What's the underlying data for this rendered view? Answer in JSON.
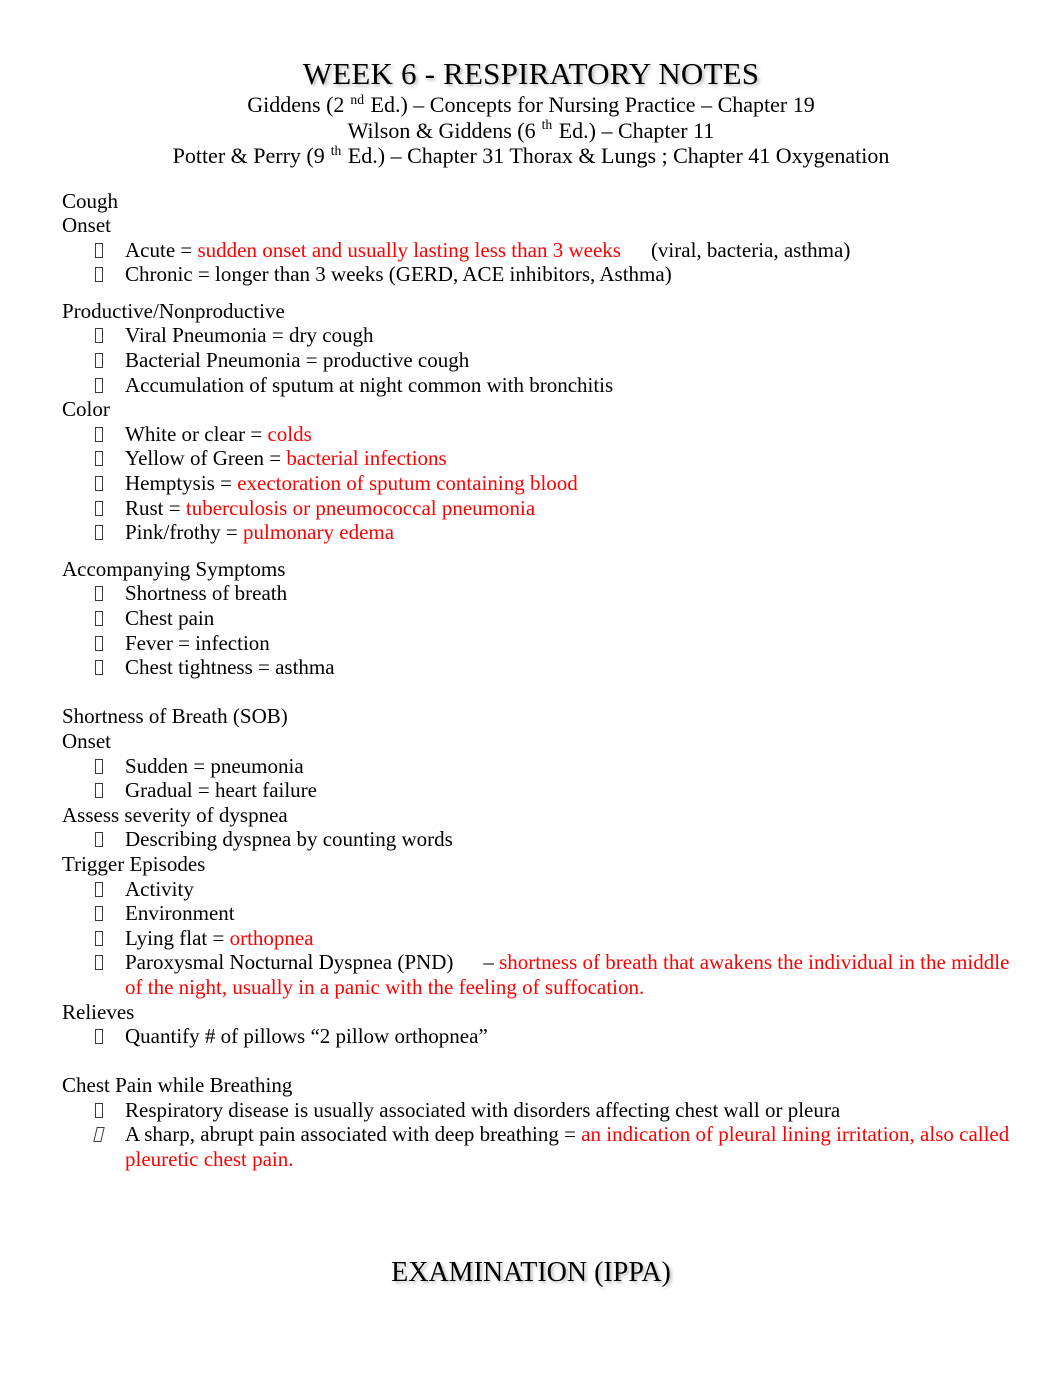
{
  "document": {
    "title": "WEEK 6 - RESPIRATORY NOTES",
    "subtitles": [
      {
        "pre": "Giddens (2",
        "sup": "nd",
        "post": " Ed.) – Concepts for Nursing Practice – Chapter 19"
      },
      {
        "pre": "Wilson & Giddens (6",
        "sup": "th",
        "post": " Ed.) – Chapter 11"
      },
      {
        "pre": "Potter & Perry (9",
        "sup": "th",
        "post": " Ed.) – Chapter 31 Thorax & Lungs ; Chapter 41 Oxygenation"
      }
    ],
    "bottom_heading": "EXAMINATION (IPPA)"
  },
  "colors": {
    "emphasis_red": "#ff0000",
    "body_text": "#000000",
    "bullet_glyph": "#3a3a3a"
  },
  "sections": {
    "cough": {
      "heading": "Cough",
      "onset_heading": "Onset",
      "onset_items": {
        "acute_label": "Acute = ",
        "acute_red": "sudden onset and usually lasting less than 3 weeks",
        "acute_trail": "(viral, bacteria, asthma)",
        "chronic": "Chronic = longer than 3 weeks (GERD, ACE inhibitors, Asthma)"
      },
      "productive_heading": "Productive/Nonproductive",
      "productive_items": {
        "viral": "Viral Pneumonia = dry cough",
        "bacterial": "Bacterial Pneumonia = productive cough",
        "accumulation": "Accumulation of sputum at night common with bronchitis"
      },
      "color_heading": "Color",
      "color_items": {
        "white_label": "White or clear = ",
        "white_red": "colds",
        "yellow_label": "Yellow of Green = ",
        "yellow_red": "bacterial infections",
        "hemoptysis_label": "Hemptysis = ",
        "hemoptysis_red": "exectoration of sputum containing blood",
        "rust_label": "Rust = ",
        "rust_red": "tuberculosis or pneumococcal pneumonia",
        "pink_label": "Pink/frothy = ",
        "pink_red": "pulmonary edema"
      },
      "symptoms_heading": "Accompanying Symptoms",
      "symptoms_items": {
        "sob": "Shortness of breath",
        "chest_pain": "Chest pain",
        "fever": "Fever = infection",
        "tightness": "Chest tightness = asthma"
      }
    },
    "sob": {
      "heading": "Shortness of Breath (SOB)",
      "onset_heading": "Onset",
      "onset_items": {
        "sudden": "Sudden = pneumonia",
        "gradual": "Gradual = heart failure"
      },
      "assess_heading": "Assess severity of dyspnea",
      "assess_items": {
        "describing": "Describing dyspnea by counting words"
      },
      "trigger_heading": "Trigger Episodes",
      "trigger_items": {
        "activity": "Activity",
        "environment": "Environment",
        "lying_label": "Lying flat = ",
        "lying_red": "orthopnea",
        "pnd_label": "Paroxysmal Nocturnal Dyspnea (PND)",
        "pnd_dash": "– ",
        "pnd_red": "shortness of breath that awakens the individual in the middle of the night, usually in a panic with the feeling of suffocation."
      },
      "relieves_heading": "Relieves",
      "relieves_items": {
        "quantify": "Quantify # of pillows “2 pillow orthopnea”"
      }
    },
    "chest_pain": {
      "heading": "Chest Pain while Breathing",
      "items": {
        "respiratory": "Respiratory disease is usually associated with disorders affecting chest wall or pleura",
        "sharp_label": "A sharp, abrupt pain associated with deep breathing = ",
        "sharp_red": "an indication of pleural lining irritation, also called pleuretic chest pain."
      }
    }
  }
}
